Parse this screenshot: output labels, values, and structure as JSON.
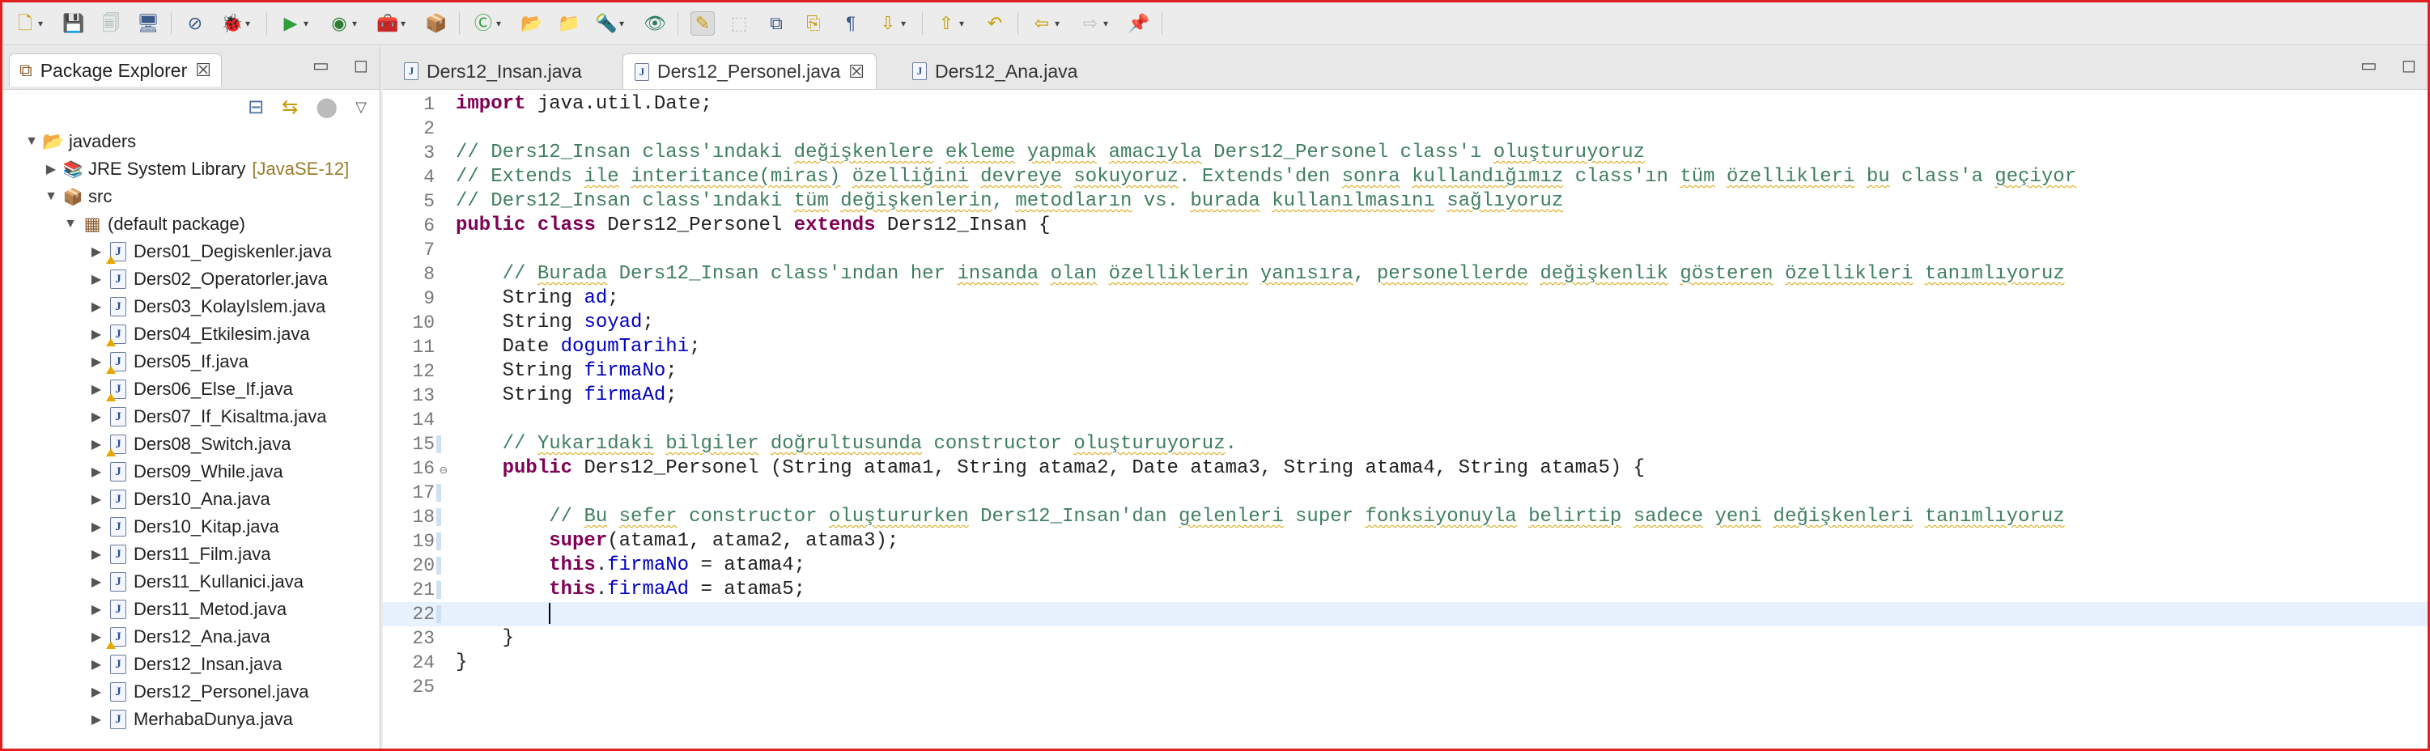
{
  "toolbar": {
    "items": [
      {
        "id": "new",
        "icon": "new-wizard-icon",
        "glyph": "🗋",
        "arrow": true
      },
      {
        "id": "save",
        "icon": "save-icon",
        "glyph": "💾",
        "arrow": false
      },
      {
        "id": "save-all",
        "icon": "save-all-icon",
        "glyph": "🗐",
        "arrow": false
      },
      {
        "id": "terminal",
        "icon": "terminal-icon",
        "glyph": "🖥",
        "arrow": false
      },
      {
        "id": "skip-breakpoints",
        "icon": "skip-breakpoints-icon",
        "glyph": "⊘",
        "arrow": false
      },
      {
        "id": "debug",
        "icon": "debug-icon",
        "glyph": "🐞",
        "arrow": true
      },
      {
        "id": "run",
        "icon": "run-icon",
        "glyph": "▶",
        "arrow": true
      },
      {
        "id": "coverage",
        "icon": "coverage-icon",
        "glyph": "◉",
        "arrow": true
      },
      {
        "id": "external-tools",
        "icon": "external-tools-icon",
        "glyph": "🧰",
        "arrow": true
      },
      {
        "id": "new-package",
        "icon": "new-package-icon",
        "glyph": "📦",
        "arrow": false
      },
      {
        "id": "new-class",
        "icon": "new-class-icon",
        "glyph": "Ⓒ",
        "arrow": true
      },
      {
        "id": "open-type",
        "icon": "open-type-icon",
        "glyph": "📂",
        "arrow": false
      },
      {
        "id": "open-task",
        "icon": "open-task-icon",
        "glyph": "📁",
        "arrow": false
      },
      {
        "id": "search",
        "icon": "search-icon",
        "glyph": "🔦",
        "arrow": true
      },
      {
        "id": "toggle-mark",
        "icon": "mark-occurrences-icon",
        "glyph": "👁",
        "arrow": false
      },
      {
        "id": "highlight",
        "icon": "highlight-icon",
        "glyph": "✎",
        "arrow": false
      },
      {
        "id": "block-select",
        "icon": "block-selection-icon",
        "glyph": "⬚",
        "arrow": false
      },
      {
        "id": "breadcrumb",
        "icon": "breadcrumb-icon",
        "glyph": "⧉",
        "arrow": false
      },
      {
        "id": "word-wrap",
        "icon": "word-wrap-icon",
        "glyph": "⎘",
        "arrow": false
      },
      {
        "id": "whitespace",
        "icon": "show-whitespace-icon",
        "glyph": "¶",
        "arrow": false
      },
      {
        "id": "next-annotation",
        "icon": "next-annotation-icon",
        "glyph": "⇩",
        "arrow": true
      },
      {
        "id": "prev-annotation",
        "icon": "previous-annotation-icon",
        "glyph": "⇧",
        "arrow": true
      },
      {
        "id": "last-edit",
        "icon": "last-edit-location-icon",
        "glyph": "↶",
        "arrow": false
      },
      {
        "id": "back",
        "icon": "back-icon",
        "glyph": "⇦",
        "arrow": true
      },
      {
        "id": "forward",
        "icon": "forward-icon",
        "glyph": "⇨",
        "arrow": true
      },
      {
        "id": "pin-editor",
        "icon": "pin-editor-icon",
        "glyph": "📌",
        "arrow": false
      }
    ]
  },
  "package_explorer": {
    "title": "Package Explorer",
    "tree": [
      {
        "label": "javaders",
        "level": 0,
        "kind": "project",
        "twisty": "▼"
      },
      {
        "label": "JRE System Library",
        "suffix": "[JavaSE-12]",
        "level": 1,
        "kind": "library",
        "twisty": "▶"
      },
      {
        "label": "src",
        "level": 1,
        "kind": "src",
        "twisty": "▼"
      },
      {
        "label": "(default package)",
        "level": 2,
        "kind": "package",
        "twisty": "▼"
      },
      {
        "label": "Ders01_Degiskenler.java",
        "level": 3,
        "kind": "file",
        "warn": true,
        "twisty": "▶"
      },
      {
        "label": "Ders02_Operatorler.java",
        "level": 3,
        "kind": "file",
        "warn": false,
        "twisty": "▶"
      },
      {
        "label": "Ders03_KolayIslem.java",
        "level": 3,
        "kind": "file",
        "warn": false,
        "twisty": "▶"
      },
      {
        "label": "Ders04_Etkilesim.java",
        "level": 3,
        "kind": "file",
        "warn": true,
        "twisty": "▶"
      },
      {
        "label": "Ders05_If.java",
        "level": 3,
        "kind": "file",
        "warn": true,
        "twisty": "▶"
      },
      {
        "label": "Ders06_Else_If.java",
        "level": 3,
        "kind": "file",
        "warn": true,
        "twisty": "▶"
      },
      {
        "label": "Ders07_If_Kisaltma.java",
        "level": 3,
        "kind": "file",
        "warn": false,
        "twisty": "▶"
      },
      {
        "label": "Ders08_Switch.java",
        "level": 3,
        "kind": "file",
        "warn": true,
        "twisty": "▶"
      },
      {
        "label": "Ders09_While.java",
        "level": 3,
        "kind": "file",
        "warn": false,
        "twisty": "▶"
      },
      {
        "label": "Ders10_Ana.java",
        "level": 3,
        "kind": "file",
        "warn": false,
        "twisty": "▶"
      },
      {
        "label": "Ders10_Kitap.java",
        "level": 3,
        "kind": "file",
        "warn": false,
        "twisty": "▶"
      },
      {
        "label": "Ders11_Film.java",
        "level": 3,
        "kind": "file",
        "warn": false,
        "twisty": "▶"
      },
      {
        "label": "Ders11_Kullanici.java",
        "level": 3,
        "kind": "file",
        "warn": false,
        "twisty": "▶"
      },
      {
        "label": "Ders11_Metod.java",
        "level": 3,
        "kind": "file",
        "warn": false,
        "twisty": "▶"
      },
      {
        "label": "Ders12_Ana.java",
        "level": 3,
        "kind": "file",
        "warn": true,
        "twisty": "▶"
      },
      {
        "label": "Ders12_Insan.java",
        "level": 3,
        "kind": "file",
        "warn": false,
        "twisty": "▶"
      },
      {
        "label": "Ders12_Personel.java",
        "level": 3,
        "kind": "file",
        "warn": false,
        "twisty": "▶"
      },
      {
        "label": "MerhabaDunya.java",
        "level": 3,
        "kind": "file",
        "warn": false,
        "twisty": "▶"
      }
    ]
  },
  "editor": {
    "tabs": [
      {
        "label": "Ders12_Insan.java",
        "active": false
      },
      {
        "label": "Ders12_Personel.java",
        "active": true
      },
      {
        "label": "Ders12_Ana.java",
        "active": false
      }
    ],
    "current_line": 22,
    "lines": [
      [
        {
          "t": "kw",
          "v": "import"
        },
        {
          "t": "p",
          "v": " java.util.Date;"
        }
      ],
      [],
      [
        {
          "t": "cm",
          "v": "// Ders12_Insan class'ındaki "
        },
        {
          "t": "cmsq",
          "v": "değişkenlere"
        },
        {
          "t": "cm",
          "v": " "
        },
        {
          "t": "cmsq",
          "v": "ekleme"
        },
        {
          "t": "cm",
          "v": " "
        },
        {
          "t": "cmsq",
          "v": "yapmak"
        },
        {
          "t": "cm",
          "v": " "
        },
        {
          "t": "cmsq",
          "v": "amacıyla"
        },
        {
          "t": "cm",
          "v": " Ders12_Personel class'ı "
        },
        {
          "t": "cmsq",
          "v": "oluşturuyoruz"
        }
      ],
      [
        {
          "t": "cm",
          "v": "// Extends "
        },
        {
          "t": "cmsq",
          "v": "ile"
        },
        {
          "t": "cm",
          "v": " "
        },
        {
          "t": "cmsq",
          "v": "interitance(miras)"
        },
        {
          "t": "cm",
          "v": " "
        },
        {
          "t": "cmsq",
          "v": "özelliğini"
        },
        {
          "t": "cm",
          "v": " "
        },
        {
          "t": "cmsq",
          "v": "devreye"
        },
        {
          "t": "cm",
          "v": " "
        },
        {
          "t": "cmsq",
          "v": "sokuyoruz"
        },
        {
          "t": "cm",
          "v": ". Extends'den "
        },
        {
          "t": "cmsq",
          "v": "sonra"
        },
        {
          "t": "cm",
          "v": " "
        },
        {
          "t": "cmsq",
          "v": "kullandığımız"
        },
        {
          "t": "cm",
          "v": " class'ın "
        },
        {
          "t": "cmsq",
          "v": "tüm"
        },
        {
          "t": "cm",
          "v": " "
        },
        {
          "t": "cmsq",
          "v": "özellikleri"
        },
        {
          "t": "cm",
          "v": " "
        },
        {
          "t": "cmsq",
          "v": "bu"
        },
        {
          "t": "cm",
          "v": " class'a "
        },
        {
          "t": "cmsq",
          "v": "geçiyor"
        }
      ],
      [
        {
          "t": "cm",
          "v": "// Ders12_Insan class'ındaki "
        },
        {
          "t": "cmsq",
          "v": "tüm"
        },
        {
          "t": "cm",
          "v": " "
        },
        {
          "t": "cmsq",
          "v": "değişkenlerin"
        },
        {
          "t": "cm",
          "v": ", "
        },
        {
          "t": "cmsq",
          "v": "metodların"
        },
        {
          "t": "cm",
          "v": " vs. "
        },
        {
          "t": "cmsq",
          "v": "burada"
        },
        {
          "t": "cm",
          "v": " "
        },
        {
          "t": "cmsq",
          "v": "kullanılmasını"
        },
        {
          "t": "cm",
          "v": " "
        },
        {
          "t": "cmsq",
          "v": "sağlıyoruz"
        }
      ],
      [
        {
          "t": "kw",
          "v": "public"
        },
        {
          "t": "p",
          "v": " "
        },
        {
          "t": "kw",
          "v": "class"
        },
        {
          "t": "p",
          "v": " Ders12_Personel "
        },
        {
          "t": "kw",
          "v": "extends"
        },
        {
          "t": "p",
          "v": " Ders12_Insan {"
        }
      ],
      [],
      [
        {
          "t": "p",
          "v": "    "
        },
        {
          "t": "cm",
          "v": "// "
        },
        {
          "t": "cmsq",
          "v": "Burada"
        },
        {
          "t": "cm",
          "v": " Ders12_Insan class'ından her "
        },
        {
          "t": "cmsq",
          "v": "insanda"
        },
        {
          "t": "cm",
          "v": " "
        },
        {
          "t": "cmsq",
          "v": "olan"
        },
        {
          "t": "cm",
          "v": " "
        },
        {
          "t": "cmsq",
          "v": "özelliklerin"
        },
        {
          "t": "cm",
          "v": " "
        },
        {
          "t": "cmsq",
          "v": "yanısıra"
        },
        {
          "t": "cm",
          "v": ", "
        },
        {
          "t": "cmsq",
          "v": "personellerde"
        },
        {
          "t": "cm",
          "v": " "
        },
        {
          "t": "cmsq",
          "v": "değişkenlik"
        },
        {
          "t": "cm",
          "v": " "
        },
        {
          "t": "cmsq",
          "v": "gösteren"
        },
        {
          "t": "cm",
          "v": " "
        },
        {
          "t": "cmsq",
          "v": "özellikleri"
        },
        {
          "t": "cm",
          "v": " "
        },
        {
          "t": "cmsq",
          "v": "tanımlıyoruz"
        }
      ],
      [
        {
          "t": "p",
          "v": "    String "
        },
        {
          "t": "fld",
          "v": "ad"
        },
        {
          "t": "p",
          "v": ";"
        }
      ],
      [
        {
          "t": "p",
          "v": "    String "
        },
        {
          "t": "fld",
          "v": "soyad"
        },
        {
          "t": "p",
          "v": ";"
        }
      ],
      [
        {
          "t": "p",
          "v": "    Date "
        },
        {
          "t": "fld",
          "v": "dogumTarihi"
        },
        {
          "t": "p",
          "v": ";"
        }
      ],
      [
        {
          "t": "p",
          "v": "    String "
        },
        {
          "t": "fld",
          "v": "firmaNo"
        },
        {
          "t": "p",
          "v": ";"
        }
      ],
      [
        {
          "t": "p",
          "v": "    String "
        },
        {
          "t": "fld",
          "v": "firmaAd"
        },
        {
          "t": "p",
          "v": ";"
        }
      ],
      [],
      [
        {
          "t": "p",
          "v": "    "
        },
        {
          "t": "cm",
          "v": "// "
        },
        {
          "t": "cmsq",
          "v": "Yukarıdaki"
        },
        {
          "t": "cm",
          "v": " "
        },
        {
          "t": "cmsq",
          "v": "bilgiler"
        },
        {
          "t": "cm",
          "v": " "
        },
        {
          "t": "cmsq",
          "v": "doğrultusunda"
        },
        {
          "t": "cm",
          "v": " constructor "
        },
        {
          "t": "cmsq",
          "v": "oluşturuyoruz"
        },
        {
          "t": "cm",
          "v": "."
        }
      ],
      [
        {
          "t": "p",
          "v": "    "
        },
        {
          "t": "kw",
          "v": "public"
        },
        {
          "t": "p",
          "v": " Ders12_Personel (String atama1, String atama2, Date atama3, String atama4, String atama5) {"
        }
      ],
      [],
      [
        {
          "t": "p",
          "v": "        "
        },
        {
          "t": "cm",
          "v": "// "
        },
        {
          "t": "cmsq",
          "v": "Bu"
        },
        {
          "t": "cm",
          "v": " "
        },
        {
          "t": "cmsq",
          "v": "sefer"
        },
        {
          "t": "cm",
          "v": " constructor "
        },
        {
          "t": "cmsq",
          "v": "oluştururken"
        },
        {
          "t": "cm",
          "v": " Ders12_Insan'dan "
        },
        {
          "t": "cmsq",
          "v": "gelenleri"
        },
        {
          "t": "cm",
          "v": " super "
        },
        {
          "t": "cmsq",
          "v": "fonksiyonuyla"
        },
        {
          "t": "cm",
          "v": " "
        },
        {
          "t": "cmsq",
          "v": "belirtip"
        },
        {
          "t": "cm",
          "v": " "
        },
        {
          "t": "cmsq",
          "v": "sadece"
        },
        {
          "t": "cm",
          "v": " "
        },
        {
          "t": "cmsq",
          "v": "yeni"
        },
        {
          "t": "cm",
          "v": " "
        },
        {
          "t": "cmsq",
          "v": "değişkenleri"
        },
        {
          "t": "cm",
          "v": " "
        },
        {
          "t": "cmsq",
          "v": "tanımlıyoruz"
        }
      ],
      [
        {
          "t": "p",
          "v": "        "
        },
        {
          "t": "kw",
          "v": "super"
        },
        {
          "t": "p",
          "v": "(atama1, atama2, atama3);"
        }
      ],
      [
        {
          "t": "p",
          "v": "        "
        },
        {
          "t": "kw",
          "v": "this"
        },
        {
          "t": "p",
          "v": "."
        },
        {
          "t": "fld",
          "v": "firmaNo"
        },
        {
          "t": "p",
          "v": " = atama4;"
        }
      ],
      [
        {
          "t": "p",
          "v": "        "
        },
        {
          "t": "kw",
          "v": "this"
        },
        {
          "t": "p",
          "v": "."
        },
        {
          "t": "fld",
          "v": "firmaAd"
        },
        {
          "t": "p",
          "v": " = atama5;"
        }
      ],
      [
        {
          "t": "p",
          "v": "        "
        },
        {
          "t": "caret",
          "v": ""
        }
      ],
      [
        {
          "t": "p",
          "v": "    }"
        }
      ],
      [
        {
          "t": "p",
          "v": "}"
        }
      ],
      []
    ]
  },
  "colors": {
    "keyword": "#7f0055",
    "comment": "#3f7f5f",
    "field": "#0000c0",
    "current_line": "#e8f2fe",
    "window_border": "#e02020"
  }
}
